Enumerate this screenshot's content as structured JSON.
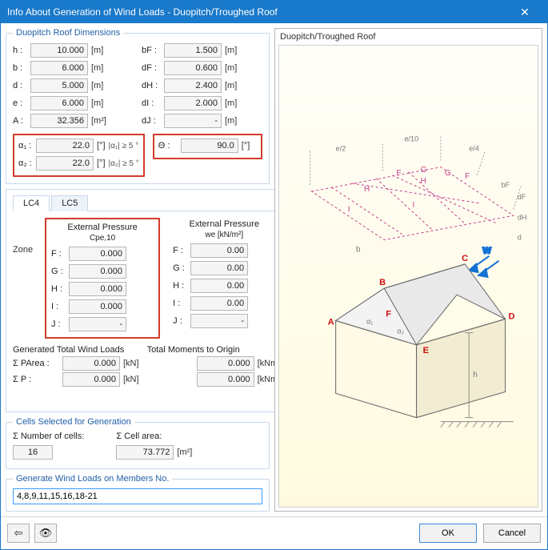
{
  "title": "Info About Generation of Wind Loads  -  Duopitch/Troughed Roof",
  "groups": {
    "dimensions": "Duopitch Roof Dimensions",
    "cells": "Cells Selected for Generation",
    "members": "Generate Wind Loads on Members No."
  },
  "dims": {
    "h": {
      "label": "h :",
      "value": "10.000",
      "unit": "[m]"
    },
    "b": {
      "label": "b :",
      "value": "6.000",
      "unit": "[m]"
    },
    "d": {
      "label": "d :",
      "value": "5.000",
      "unit": "[m]"
    },
    "e": {
      "label": "e :",
      "value": "6.000",
      "unit": "[m]"
    },
    "A": {
      "label": "A :",
      "value": "32.356",
      "unit": "[m²]"
    },
    "bF": {
      "label": "bF :",
      "value": "1.500",
      "unit": "[m]"
    },
    "dF": {
      "label": "dF :",
      "value": "0.600",
      "unit": "[m]"
    },
    "dH": {
      "label": "dH :",
      "value": "2.400",
      "unit": "[m]"
    },
    "dI": {
      "label": "dI :",
      "value": "2.000",
      "unit": "[m]"
    },
    "dJ": {
      "label": "dJ :",
      "value": "-",
      "unit": "[m]"
    },
    "a1": {
      "label": "α₁ :",
      "value": "22.0",
      "unit": "[°]",
      "note": "|α₁| ≥ 5 °"
    },
    "a2": {
      "label": "α₂ :",
      "value": "22.0",
      "unit": "[°]",
      "note": "|α₂| ≥ 5 °"
    },
    "theta": {
      "label": "Θ :",
      "value": "90.0",
      "unit": "[°]"
    }
  },
  "tabs": {
    "lc4": "LC4",
    "lc5": "LC5"
  },
  "zone_header": "Zone",
  "pressure": {
    "ext_title": "External Pressure",
    "cpe_sub": "Cpe,10",
    "we_sub": "we [kN/m²]",
    "F": {
      "label": "F :",
      "cpe": "0.000",
      "we": "0.00"
    },
    "G": {
      "label": "G :",
      "cpe": "0.000",
      "we": "0.00"
    },
    "H": {
      "label": "H :",
      "cpe": "0.000",
      "we": "0.00"
    },
    "I": {
      "label": "I :",
      "cpe": "0.000",
      "we": "0.00"
    },
    "J": {
      "label": "J :",
      "cpe": "-",
      "we": "-"
    }
  },
  "totals": {
    "gen_title": "Generated Total Wind Loads",
    "mom_title": "Total Moments to Origin",
    "pArea": {
      "label": "Σ PArea :",
      "value": "0.000",
      "unit": "[kN]"
    },
    "p": {
      "label": "Σ P :",
      "value": "0.000",
      "unit": "[kN]"
    },
    "m1": {
      "value": "0.000",
      "unit": "[kNm]"
    },
    "m2": {
      "value": "0.000",
      "unit": "[kNm]"
    }
  },
  "cells": {
    "numLabel": "Σ Number of cells:",
    "num": "16",
    "areaLabel": "Σ Cell area:",
    "area": "73.772",
    "areaUnit": "[m²]"
  },
  "members": {
    "value": "4,8,9,11,15,16,18-21"
  },
  "diagram": {
    "title": "Duopitch/Troughed Roof"
  },
  "buttons": {
    "ok": "OK",
    "cancel": "Cancel"
  }
}
